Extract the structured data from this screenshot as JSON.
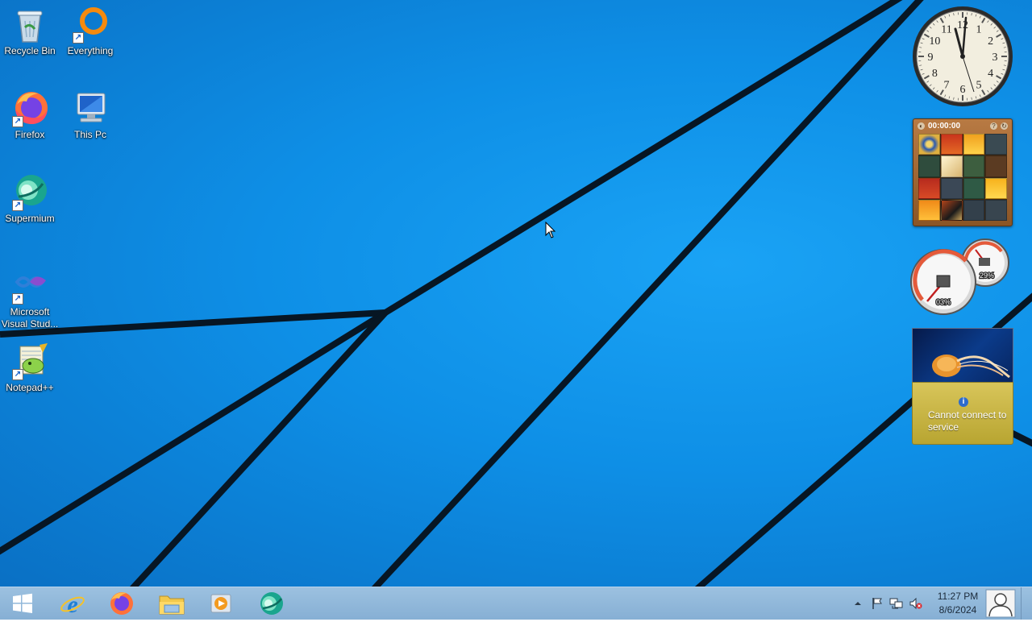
{
  "desktop_icons": [
    {
      "name": "Recycle Bin"
    },
    {
      "name": "Everything"
    },
    {
      "name": "Firefox"
    },
    {
      "name": "This Pc"
    },
    {
      "name": "Supermium"
    },
    {
      "name": "Microsoft Visual Stud..."
    },
    {
      "name": "Notepad++"
    }
  ],
  "gadgets": {
    "clock": {
      "numbers": [
        "12",
        "1",
        "2",
        "3",
        "4",
        "5",
        "6",
        "7",
        "8",
        "9",
        "10",
        "11"
      ]
    },
    "puzzle": {
      "timer": "00:00:00"
    },
    "meter": {
      "cpu": "03%",
      "memory": "29%"
    },
    "weather": {
      "message": "Cannot connect to service"
    }
  },
  "taskbar": {
    "pinned": [
      {
        "name": "Internet Explorer"
      },
      {
        "name": "Firefox"
      },
      {
        "name": "File Explorer"
      },
      {
        "name": "Media Player"
      },
      {
        "name": "Supermium"
      }
    ],
    "time": "11:27 PM",
    "date": "8/6/2024"
  },
  "colors": {
    "wallpaper": "#0e8fe6",
    "taskbar": "#9cc1e0"
  }
}
